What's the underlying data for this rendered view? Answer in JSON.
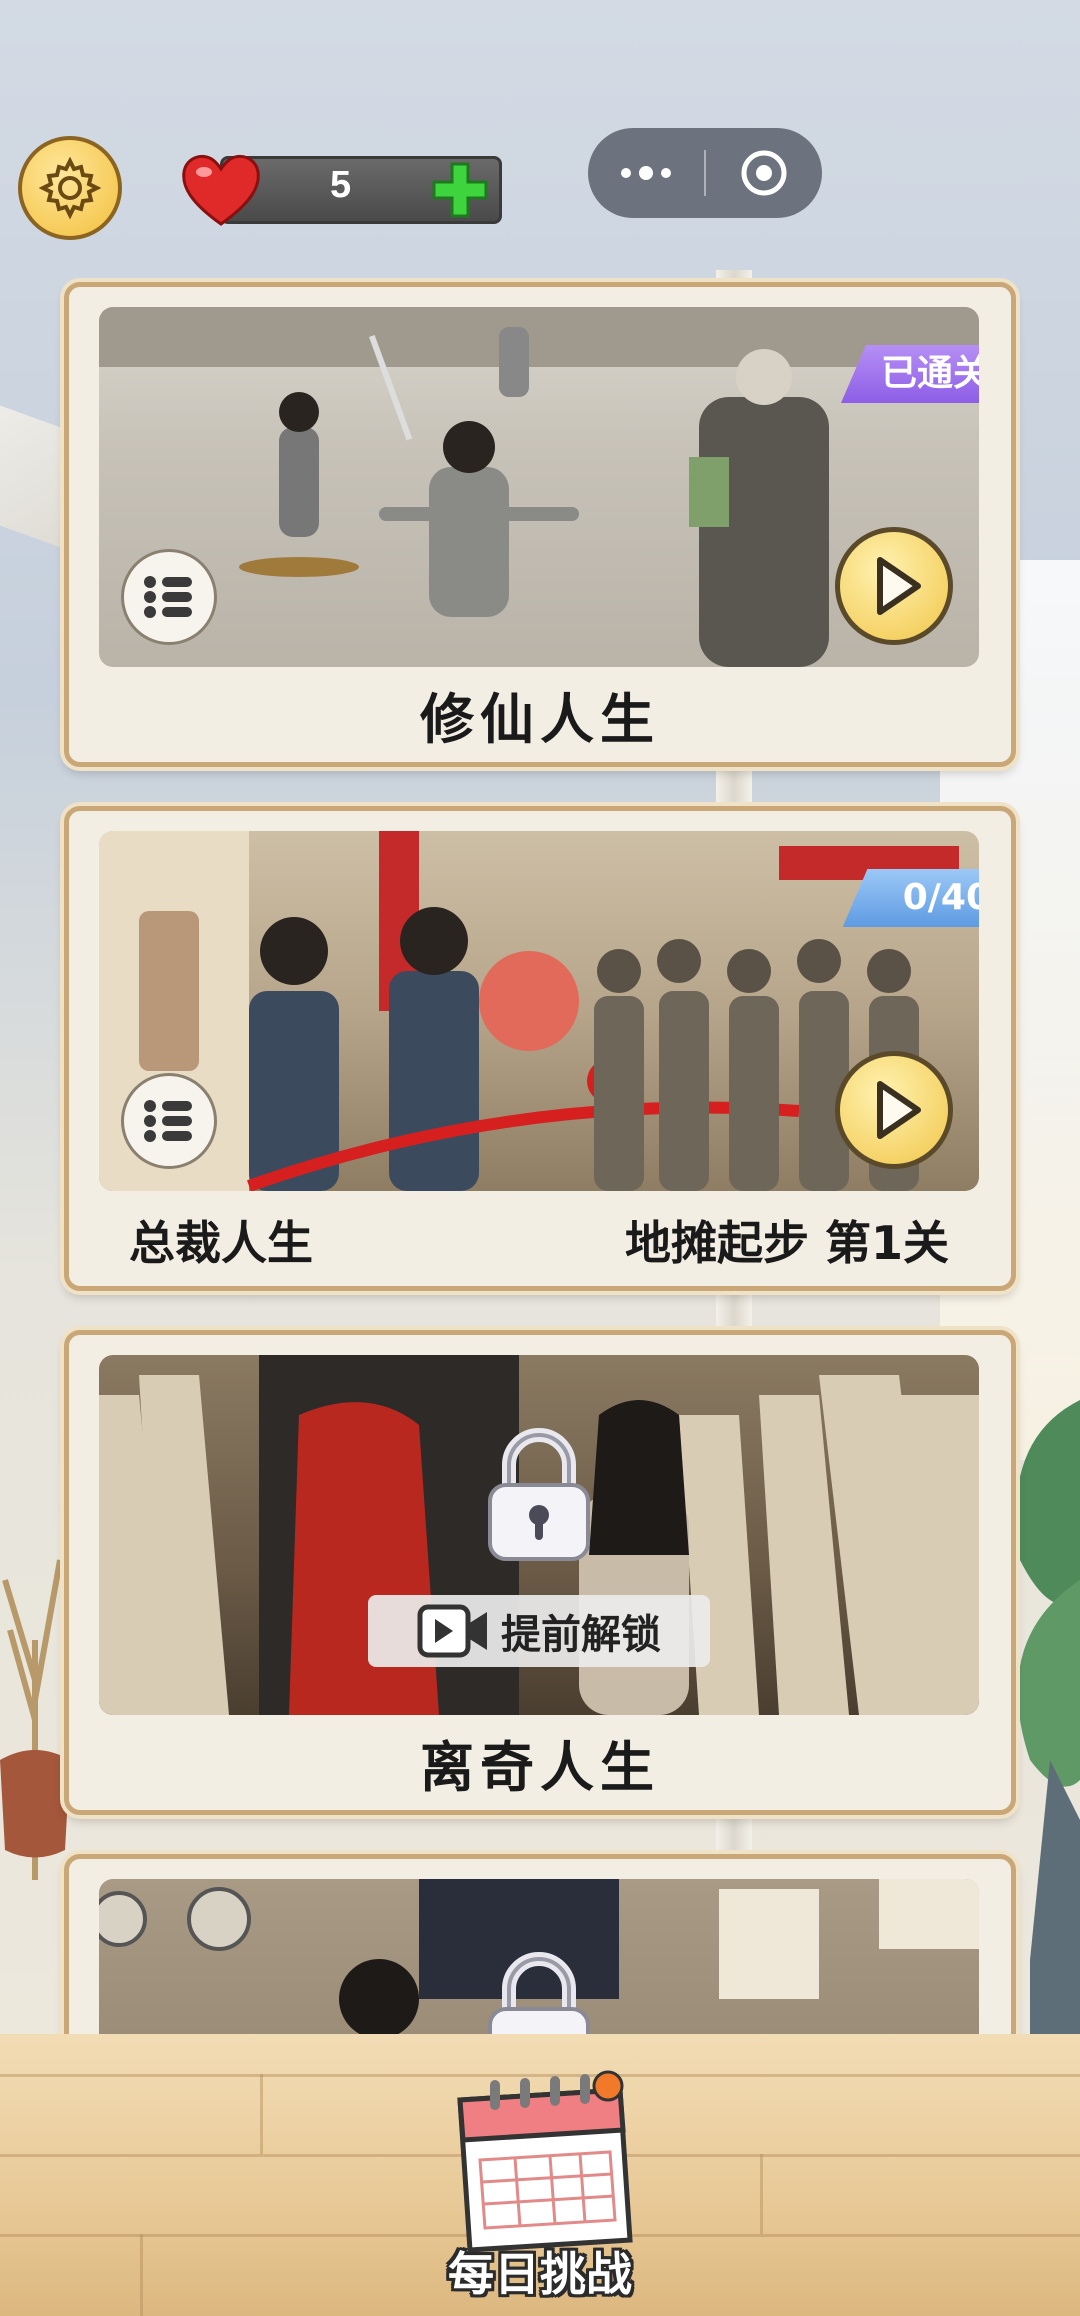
{
  "header": {
    "lives_count": "5",
    "settings_icon": "gear-icon",
    "capsule_more_icon": "more-dots-icon",
    "capsule_close_icon": "target-close-icon"
  },
  "levels": [
    {
      "title": "修仙人生",
      "badge": "已通关",
      "status": "cleared",
      "accent": "#9b6ff0"
    },
    {
      "title": "总裁人生",
      "badge": "0/40",
      "stage": "地摊起步 第1关",
      "status": "in-progress",
      "accent": "#6aa5ea"
    },
    {
      "title": "离奇人生",
      "unlock_label": "提前解锁",
      "status": "locked"
    },
    {
      "status": "locked"
    }
  ],
  "daily": {
    "label": "每日挑战"
  },
  "colors": {
    "card_border": "#c9a777",
    "card_bg": "#f3eee3",
    "play_button": "#f1c64a"
  }
}
